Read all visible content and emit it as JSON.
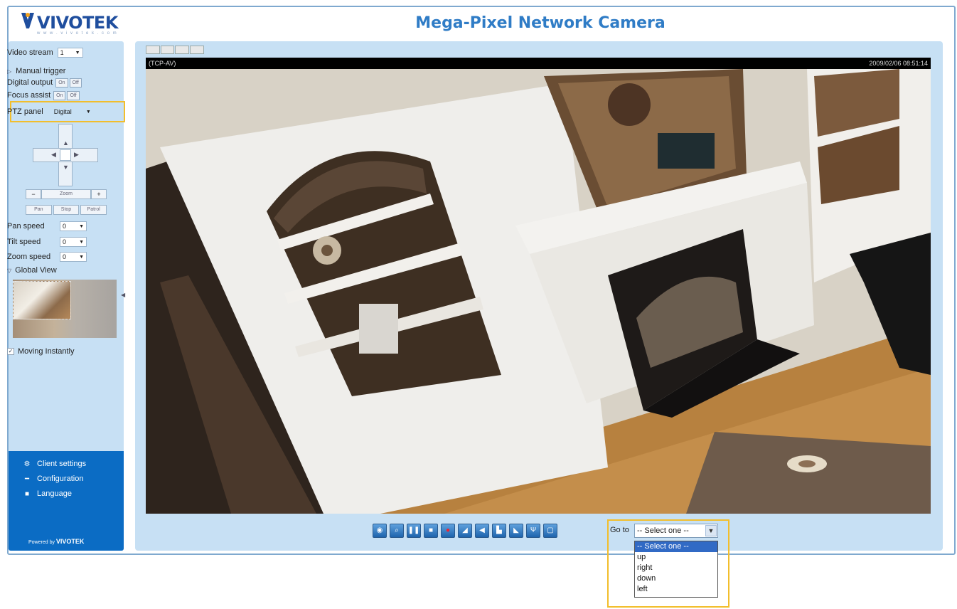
{
  "brand": {
    "logo_text": "VIVOTEK",
    "logo_sub": "w w w . v i v o t e k . c o m"
  },
  "page_title": "Mega-Pixel Network Camera",
  "sidebar": {
    "video_stream_label": "Video stream",
    "video_stream_value": "1",
    "manual_trigger_label": "Manual trigger",
    "digital_output_label": "Digital output",
    "focus_assist_label": "Focus assist",
    "on_label": "On",
    "off_label": "Off",
    "ptz_panel_label": "PTZ panel",
    "ptz_panel_value": "Digital",
    "zoom_label": "Zoom",
    "zoom_minus": "−",
    "zoom_plus": "+",
    "pan_button": "Pan",
    "stop_button": "Stop",
    "patrol_button": "Patrol",
    "pan_speed_label": "Pan speed",
    "pan_speed_value": "0",
    "tilt_speed_label": "Tilt speed",
    "tilt_speed_value": "0",
    "zoom_speed_label": "Zoom speed",
    "zoom_speed_value": "0",
    "global_view_label": "Global View",
    "moving_instantly_label": "Moving Instantly",
    "moving_instantly_checked": true
  },
  "sidebar_links": [
    {
      "label": "Client settings",
      "icon": "gear-icon"
    },
    {
      "label": "Configuration",
      "icon": "wrench-icon"
    },
    {
      "label": "Language",
      "icon": "speech-icon"
    }
  ],
  "powered_by": {
    "prefix": "Powered by",
    "brand": "VIVOTEK"
  },
  "video": {
    "stream_info": "(TCP-AV)",
    "timestamp": "2009/02/06 08:51:14"
  },
  "toolbar_icons": [
    "snapshot-icon",
    "digital-zoom-icon",
    "pause-icon",
    "stop-icon",
    "record-icon",
    "volume-icon",
    "mute-icon",
    "talk-icon",
    "speaker-icon",
    "microphone-icon",
    "fullscreen-icon"
  ],
  "goto": {
    "label": "Go to",
    "selected": "-- Select one --",
    "options": [
      "-- Select one --",
      "up",
      "right",
      "down",
      "left"
    ]
  },
  "colors": {
    "panel_bg": "#c7e0f4",
    "accent_blue": "#0b6cc4",
    "title_blue": "#2f7cc6",
    "highlight_yellow": "#f2be2c"
  }
}
